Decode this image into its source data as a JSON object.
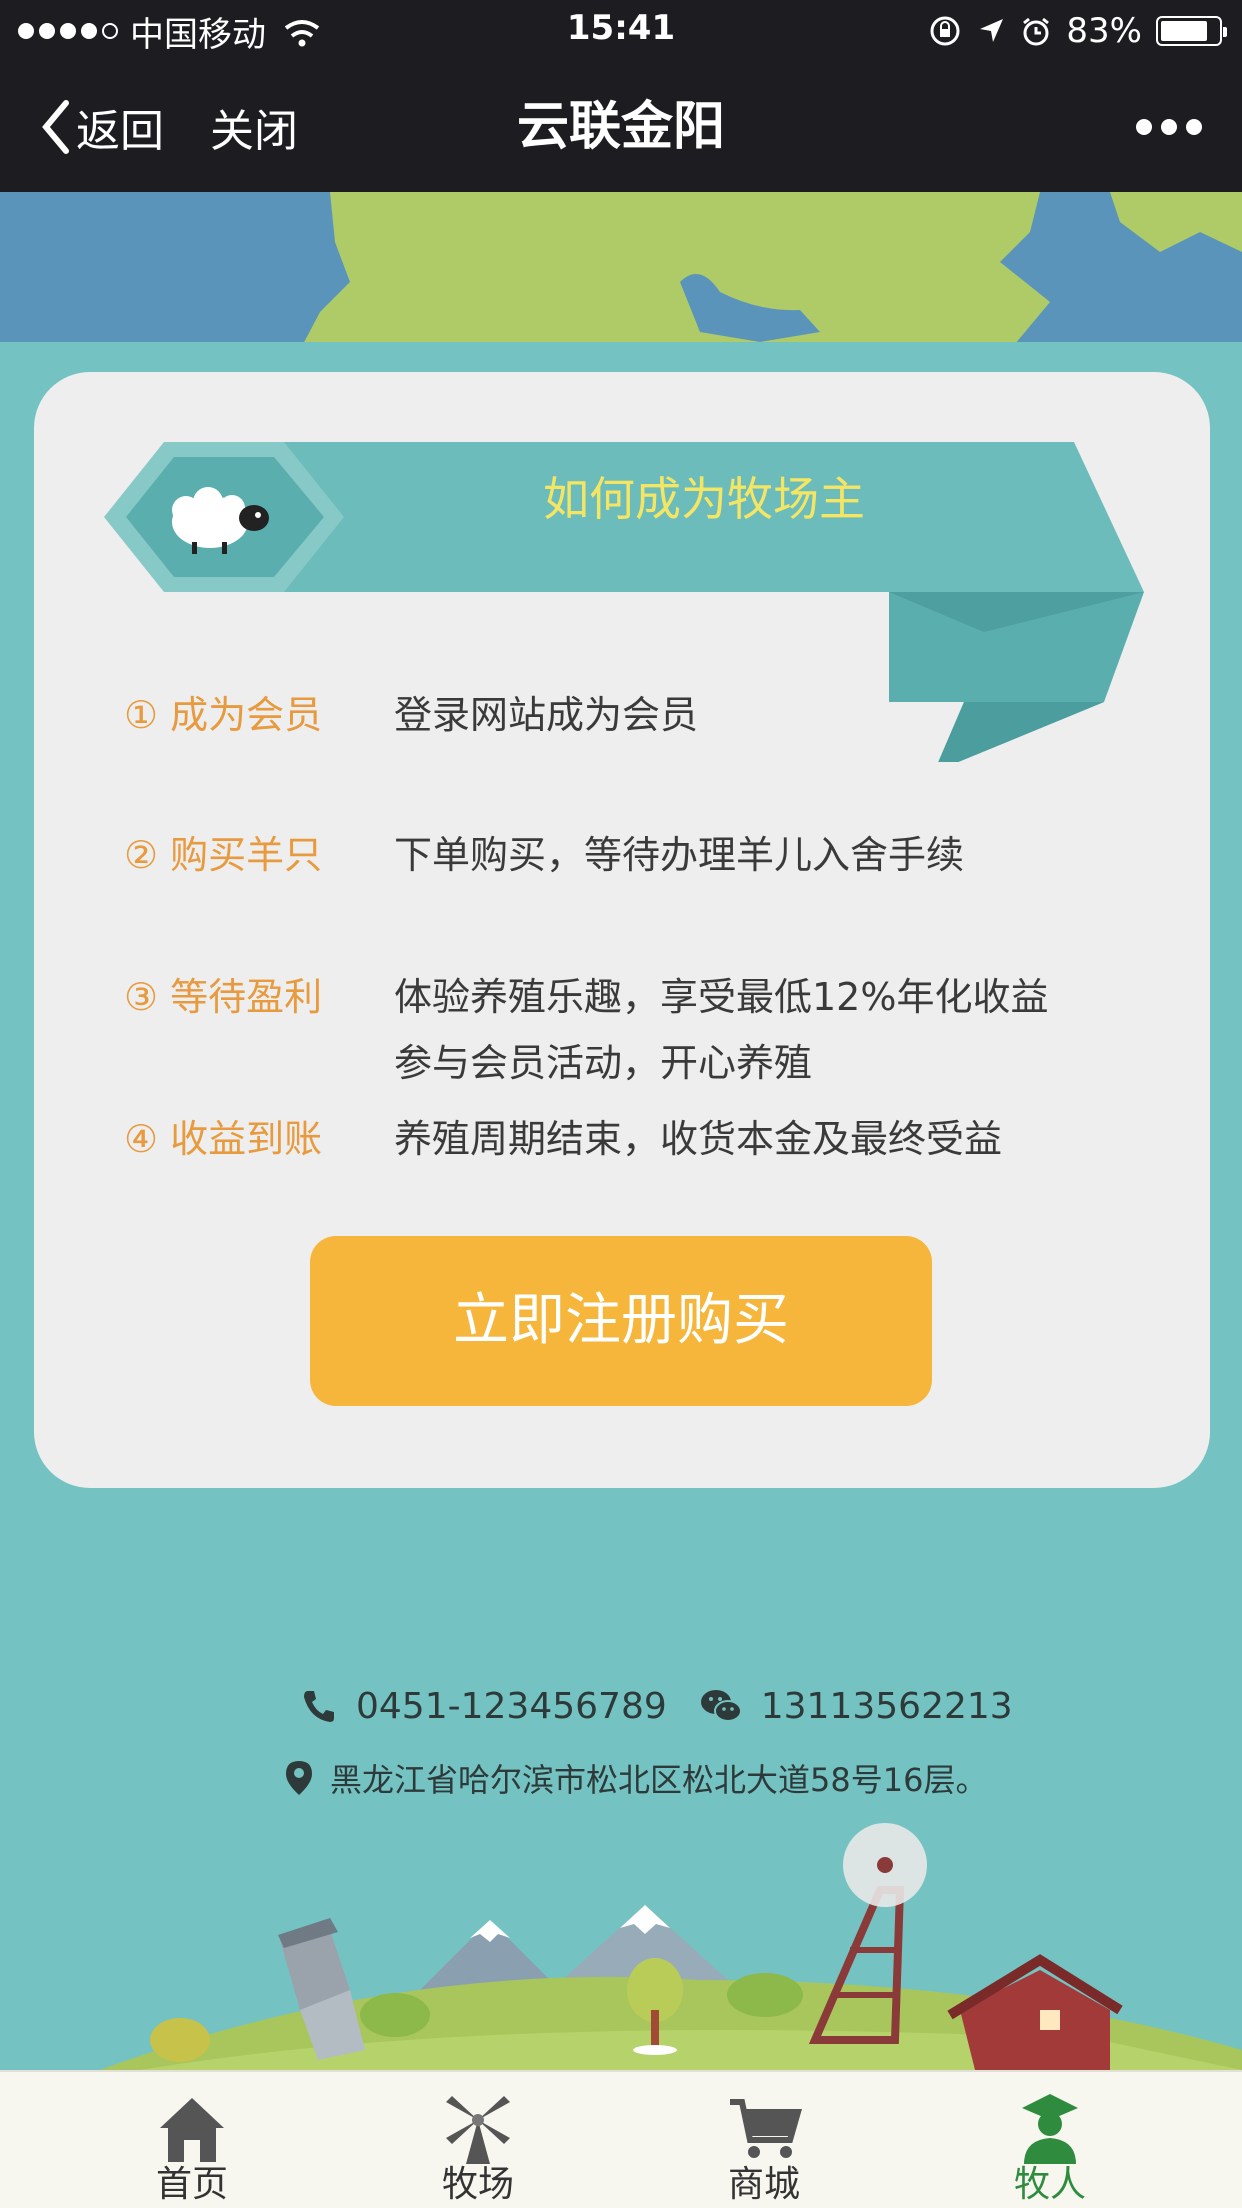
{
  "status_bar": {
    "carrier": "中国移动",
    "time": "15:41",
    "battery": "83%",
    "battery_level": 0.83
  },
  "nav": {
    "back_label": "返回",
    "close_label": "关闭",
    "title": "云联金阳"
  },
  "card": {
    "ribbon_title": "如何成为牧场主",
    "steps": [
      {
        "label": "① 成为会员",
        "lines": [
          "登录网站成为会员"
        ]
      },
      {
        "label": "② 购买羊只",
        "lines": [
          "下单购买，等待办理羊儿入舍手续"
        ]
      },
      {
        "label": "③ 等待盈利",
        "lines": [
          "体验养殖乐趣，享受最低12%年化收益",
          "参与会员活动，开心养殖"
        ]
      },
      {
        "label": "④ 收益到账",
        "lines": [
          "养殖周期结束，收货本金及最终受益"
        ]
      }
    ],
    "cta_label": "立即注册购买"
  },
  "contact": {
    "phone": "0451-123456789",
    "wechat": "13113562213",
    "address": "黑龙江省哈尔滨市松北区松北大道58号16层。"
  },
  "tabs": [
    {
      "label": "首页",
      "icon": "home-icon",
      "active": false
    },
    {
      "label": "牧场",
      "icon": "windmill-icon",
      "active": false
    },
    {
      "label": "商城",
      "icon": "cart-icon",
      "active": false
    },
    {
      "label": "牧人",
      "icon": "shepherd-icon",
      "active": true
    }
  ],
  "colors": {
    "background": "#74c3c2",
    "accent_orange": "#e89a3e",
    "cta": "#f5b63b",
    "ribbon": "#6bbcbb",
    "ribbon_title": "#f4e664",
    "active_tab": "#2f8c3e"
  }
}
